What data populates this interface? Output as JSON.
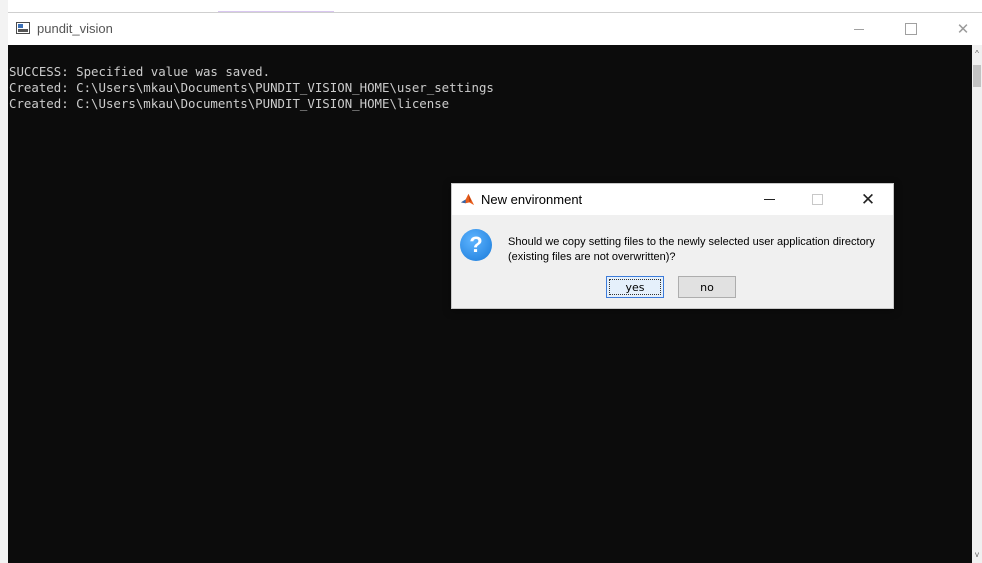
{
  "window": {
    "title": "pundit_vision",
    "controls": {
      "minimize": "minimize-icon",
      "maximize": "maximize-icon",
      "close": "✕"
    }
  },
  "console": {
    "lines": [
      "SUCCESS: Specified value was saved.",
      "Created: C:\\Users\\mkau\\Documents\\PUNDIT_VISION_HOME\\user_settings",
      "Created: C:\\Users\\mkau\\Documents\\PUNDIT_VISION_HOME\\license"
    ],
    "text_color": "#cccccc",
    "background": "#0c0c0c"
  },
  "scrollbar": {
    "up_arrow": "^",
    "down_arrow": "v"
  },
  "dialog": {
    "title": "New environment",
    "icon": "question-icon",
    "icon_glyph": "?",
    "message": "Should we copy setting files to the newly selected user application directory (existing files are not overwritten)?",
    "buttons": {
      "yes": "yes",
      "no": "no"
    },
    "close": "✕"
  }
}
